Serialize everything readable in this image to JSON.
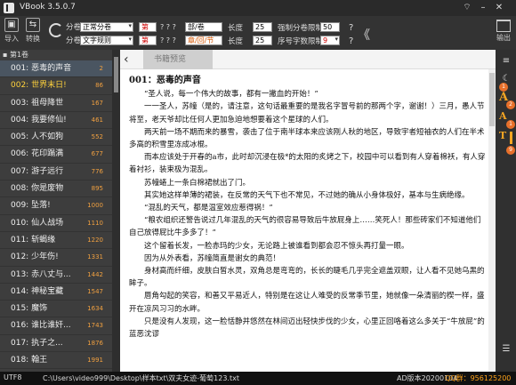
{
  "app": {
    "title": "VBook 3.5.0.7"
  },
  "toolbar": {
    "import_label": "导入",
    "convert_label": "转换",
    "split_label_1": "分卷",
    "split_label_2": "分卷",
    "mode_value": "正常分卷",
    "rule_value": "文字规则",
    "chapter_prefix": "第",
    "chapter_pattern": "? ? ?",
    "chapter_suffix": "部/卷",
    "length_label_1": "长度",
    "length_value_1": "25",
    "min_words_label": "强制分卷限制",
    "min_words_value": "50",
    "chapter_prefix_2": "第",
    "chapter_pattern_2": "? ? ?",
    "chapter_suffix_2": "章/回/节",
    "length_label_2": "长度",
    "length_value_2": "25",
    "seq_label": "序号字数限制",
    "seq_value": "9",
    "question_mark": "?",
    "question_mark_2": "?",
    "chevrons": "《",
    "output_label": "输出"
  },
  "sidebar": {
    "volume_label": "第1卷",
    "chapters": [
      {
        "title": "001: 恶毒的声音",
        "count": "2",
        "selected": true,
        "gold": false
      },
      {
        "title": "002: 世界末日!",
        "count": "86",
        "selected": false,
        "gold": true
      },
      {
        "title": "003: 祖母降世",
        "count": "167",
        "selected": false,
        "gold": false
      },
      {
        "title": "004: 我要修仙!",
        "count": "461",
        "selected": false,
        "gold": false
      },
      {
        "title": "005: 人不如狗",
        "count": "552",
        "selected": false,
        "gold": false
      },
      {
        "title": "006: 花印蹋满",
        "count": "677",
        "selected": false,
        "gold": false
      },
      {
        "title": "007: 游子远行",
        "count": "776",
        "selected": false,
        "gold": false
      },
      {
        "title": "008: 你是废物",
        "count": "895",
        "selected": false,
        "gold": false
      },
      {
        "title": "009: 坠落!",
        "count": "1000",
        "selected": false,
        "gold": false
      },
      {
        "title": "010: 仙人战场",
        "count": "1110",
        "selected": false,
        "gold": false
      },
      {
        "title": "011: 斩蝎缘",
        "count": "1220",
        "selected": false,
        "gold": false
      },
      {
        "title": "012: 少年伤!",
        "count": "1331",
        "selected": false,
        "gold": false
      },
      {
        "title": "013: 赤八丈与...",
        "count": "1442",
        "selected": false,
        "gold": false
      },
      {
        "title": "014: 神秘宝藏",
        "count": "1547",
        "selected": false,
        "gold": false
      },
      {
        "title": "015: 魔饰",
        "count": "1634",
        "selected": false,
        "gold": false
      },
      {
        "title": "016: 谁比谁奸...",
        "count": "1743",
        "selected": false,
        "gold": false
      },
      {
        "title": "017: 执子之...",
        "count": "1876",
        "selected": false,
        "gold": false
      },
      {
        "title": "018: 翰王",
        "count": "1991",
        "selected": false,
        "gold": false
      },
      {
        "title": "019: 第一杯令",
        "count": "2096",
        "selected": false,
        "gold": false
      }
    ]
  },
  "preview": {
    "tab_label": "书籍预览",
    "heading": "001：恶毒的声音",
    "paragraphs": [
      "“圣人说，每一个伟大的故事，都有一撇血的开始！”",
      "一一圣人，苏幢（是的，请注意，这句话最重要的是我名字冒号前的那两个字，谢谢！）三月，愚人节将至，老天爷却比任何人更加急迫地想要着这个星球的人们。",
      "两天前一场不期而来的暴雪，袭击了位于南半球本来应该刚人秋的地区，导致宇者短袖衣的人们在半术多高的积雪里冻成冰棍。",
      "而本应该处于开春的a市，此时却沉浸在极*的太阳的炙烤之下，校园中可以看到有人穿着棉袄，有人穿着衬衫，装束极为混乱。",
      "苏幢蜷上一条白棉裙就出了门。",
      "其实她这样单薄的裙装，在反常的天气下也不常见，不过她的确从小身体极好，基本与生病绝缘。",
      "“混乱的天气，都是温室效应惹得祸！”",
      "“粮农组织还警告说过几年混乱的天气的很容易导致后牛放屁身上……笑死人！那些砖家们不知道他们自己放得屁比牛多多了！”",
      "这个留着长发，一脸赤玛的少女，无论路上被谁看到都会忍不惊头再打量一眼。",
      "因为从外表看，苏幢简直是谢女的典范！",
      "身材高而纤细，皮肤白皙水灵，双角总是弯弯的，长长的睫毛几乎完全遮盖双眼，让人看不见她乌黑的眸子。",
      "唇角勾起的笑容，和善又平易近人，特别是在这让人难受的反常季节里，她就像一朵清丽的楔一样，盛开在凉风习习的水畔。",
      "只是没有人发现，这一脸恬静并悠然在林间迈出轻快步伐的少女，心里正回咯着这么多关于“牛放屁”的蓝恶沈谬"
    ]
  },
  "rightpanel": {
    "badges": [
      "1",
      "2",
      "1",
      "9"
    ]
  },
  "status": {
    "encoding": "UTF8",
    "path": "C:\\Users\\video999\\Desktop\\样本txt\\双夫女迹-葡萄123.txt",
    "ad_text": "AD版本20200104",
    "qq": "QQ群：956125200"
  }
}
